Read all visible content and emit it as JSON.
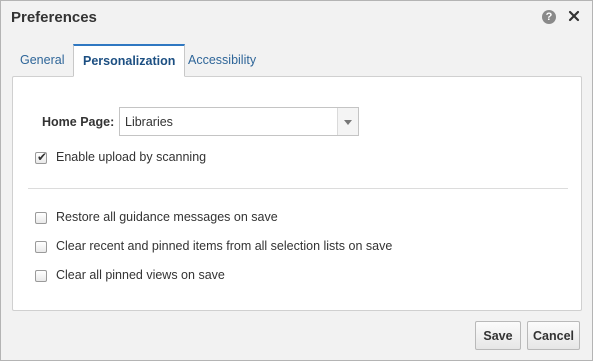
{
  "dialog": {
    "title": "Preferences",
    "help_icon": "help-icon",
    "help_glyph": "?",
    "close_icon": "close-icon"
  },
  "tabs": [
    {
      "label": "General",
      "active": false
    },
    {
      "label": "Personalization",
      "active": true
    },
    {
      "label": "Accessibility",
      "active": false
    }
  ],
  "home_page": {
    "label": "Home Page:",
    "selected": "Libraries"
  },
  "options": [
    {
      "label": "Enable upload by scanning",
      "checked": true
    },
    {
      "label": "Restore all guidance messages on save",
      "checked": false
    },
    {
      "label": "Clear recent and pinned items from all selection lists on save",
      "checked": false
    },
    {
      "label": "Clear all pinned views on save",
      "checked": false
    }
  ],
  "checkmark_glyph": "✔",
  "buttons": {
    "save": "Save",
    "cancel": "Cancel"
  },
  "colors": {
    "accent": "#2f78c2",
    "tab_link": "#2f6699"
  }
}
